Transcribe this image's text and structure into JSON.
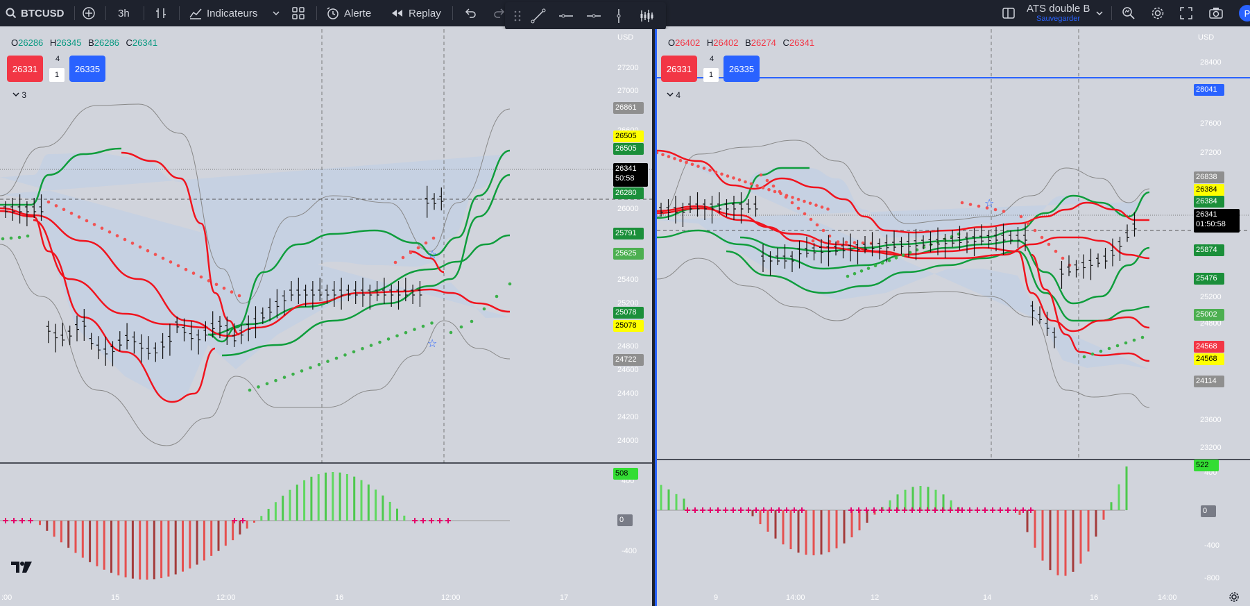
{
  "topbar": {
    "symbol": "BTCUSD",
    "interval": "3h",
    "indicators_label": "Indicateurs",
    "alert_label": "Alerte",
    "replay_label": "Replay",
    "layout_name": "ATS double B",
    "layout_save": "Sauvegarder",
    "avatar_initial": "P"
  },
  "left": {
    "ohlc": {
      "o_label": "O",
      "o": "26286",
      "h_label": "H",
      "h": "26345",
      "b_label": "B",
      "b": "26286",
      "c_label": "C",
      "c": "26341"
    },
    "sell_price": "26331",
    "buy_price": "26335",
    "qty_top": "4",
    "qty_box": "1",
    "legend_count": "3",
    "currency": "USD",
    "price_ticks": [
      "27200",
      "27000",
      "26600",
      "26000",
      "25400",
      "25200",
      "24800",
      "24600",
      "24400",
      "24200",
      "24000"
    ],
    "osc_ticks": [
      "400",
      "-400"
    ],
    "time_ticks": [
      ":00",
      "15",
      "12:00",
      "16",
      "12:00",
      "17"
    ],
    "labels": {
      "l1": "26861",
      "l2": "26505",
      "l3": "26505",
      "last": "26341",
      "countdown": "50:58",
      "l4": "26280",
      "l5": "25791",
      "l6": "25625",
      "l7": "25078",
      "l8": "25078",
      "l9": "24722",
      "osc": "508",
      "zero": "0"
    }
  },
  "right": {
    "ohlc": {
      "o_label": "O",
      "o": "26402",
      "h_label": "H",
      "h": "26402",
      "b_label": "B",
      "b": "26274",
      "c_label": "C",
      "c": "26341"
    },
    "sell_price": "26331",
    "buy_price": "26335",
    "qty_top": "4",
    "qty_box": "1",
    "legend_count": "4",
    "currency": "USD",
    "price_ticks": [
      "28400",
      "28000",
      "27600",
      "27200",
      "26000",
      "25200",
      "24800",
      "23600",
      "23200"
    ],
    "osc_ticks": [
      "400",
      "-400",
      "-800"
    ],
    "time_ticks": [
      "9",
      "14:00",
      "12",
      "14",
      "16",
      "14:00"
    ],
    "labels": {
      "hline": "28041",
      "l1": "26838",
      "l2": "26384",
      "l3": "26384",
      "last": "26341",
      "countdown": "01:50:58",
      "l4": "25874",
      "l5": "25476",
      "l6": "25002",
      "l7": "24568",
      "l8": "24568",
      "l9": "24114",
      "osc": "522",
      "zero": "0"
    }
  },
  "colors": {
    "green": "#0f9d3c",
    "red": "#f0141e",
    "band_fill": "#c3cfe4",
    "label_yellow": "#ffff00",
    "label_green": "#1b8f3a",
    "label_gray": "#8f8f8f",
    "label_red": "#f23645",
    "label_blue": "#2962ff",
    "osc_green": "#66e266",
    "osc_red": "#e5504f"
  }
}
